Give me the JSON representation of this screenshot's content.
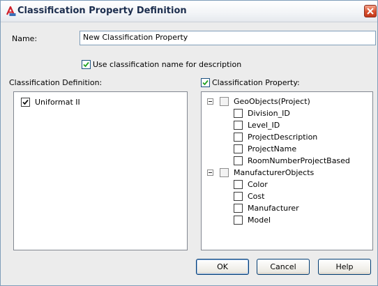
{
  "window": {
    "title": "Classification Property Definition",
    "accent": "#1b2d4d",
    "close_color": "#d9502e"
  },
  "name_field": {
    "label": "Name:",
    "value": "New Classification Property"
  },
  "use_classification_name": {
    "label": "Use classification name for description",
    "checked": true
  },
  "classification_definition": {
    "label": "Classification Definition:",
    "items": [
      {
        "label": "Uniformat II",
        "checked": true
      }
    ]
  },
  "classification_property": {
    "label": "Classification Property:",
    "checked": true,
    "tree": [
      {
        "label": "GeoObjects(Project)",
        "expanded": true,
        "checked": false,
        "children": [
          {
            "label": "Division_ID",
            "checked": false
          },
          {
            "label": "Level_ID",
            "checked": false
          },
          {
            "label": "ProjectDescription",
            "checked": false
          },
          {
            "label": "ProjectName",
            "checked": false
          },
          {
            "label": "RoomNumberProjectBased",
            "checked": false
          }
        ]
      },
      {
        "label": "ManufacturerObjects",
        "expanded": true,
        "checked": false,
        "children": [
          {
            "label": "Color",
            "checked": false
          },
          {
            "label": "Cost",
            "checked": false
          },
          {
            "label": "Manufacturer",
            "checked": false
          },
          {
            "label": "Model",
            "checked": false
          }
        ]
      }
    ]
  },
  "buttons": {
    "ok": "OK",
    "cancel": "Cancel",
    "help": "Help"
  }
}
